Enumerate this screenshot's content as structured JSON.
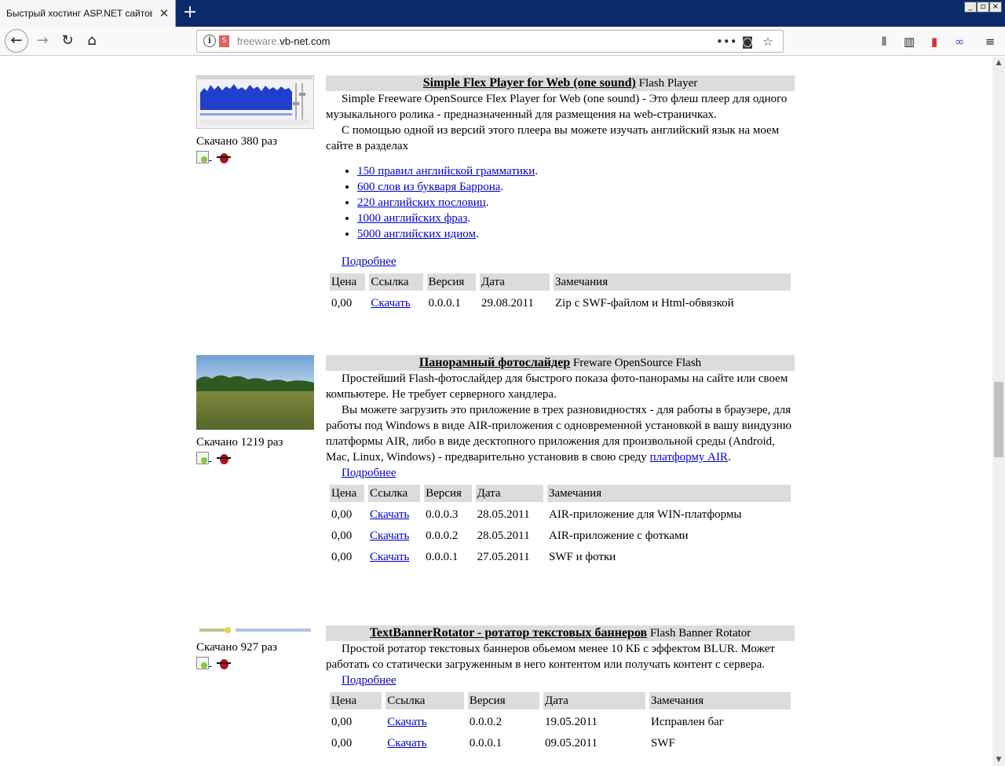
{
  "browser": {
    "tab_title": "Быстрый хостинг ASP.NET сайтов с и",
    "tab_close": "✕",
    "new_tab": "+",
    "url_prefix": "freeware.",
    "url_domain": "vb-net.com",
    "window_controls": {
      "minimize": "_",
      "restore": "▫",
      "close": "×"
    },
    "nav_icons": [
      "back-arrow-icon",
      "forward-arrow-icon",
      "reload-icon",
      "home-icon"
    ],
    "url_icons": [
      "info-icon",
      "noscript-icon",
      "page-actions-icon",
      "pocket-icon",
      "bookmark-star-icon"
    ],
    "toolbar_icons": [
      "library-icon",
      "sidebar-icon",
      "extension-icon",
      "addon-icon",
      "menu-icon"
    ]
  },
  "products": [
    {
      "title": "Simple Flex Player for Web (one sound)",
      "category": "Flash Player",
      "downloads": "Скачано 380 раз",
      "description": [
        "Simple Freeware OpenSource Flex Player for Web (one sound) - Это флеш плеер для одного музыкального ролика - предназначенный для размещения на web-страничках.",
        "С помощью одной из версий этого плеера вы можете изучать английский язык на моем сайте в разделах"
      ],
      "links": [
        "150 правил английской грамматики",
        "600 слов из букваря Баррона",
        "220 английских пословиц",
        "1000 английских фраз",
        "5000 английских идиом"
      ],
      "more": "Подробнее",
      "headers": [
        "Цена",
        "Ссылка",
        "Версия",
        "Дата",
        "Замечания"
      ],
      "rows": [
        {
          "price": "0,00",
          "link": "Скачать",
          "version": "0.0.0.1",
          "date": "29.08.2011",
          "notes": "Zip с SWF-файлом и Html-обвязкой"
        }
      ]
    },
    {
      "title": "Панорамный фотослайдер",
      "category": "Freware OpenSource Flash",
      "downloads": "Скачано 1219 раз",
      "description": [
        "Простейший Flash-фотослайдер для быстрого показа фото-панорамы на сайте или своем компьютере. Не требует серверного хандлера.",
        "Вы можете загрузить это приложение в трех разновидностях - для работы в браузере, для работы под Windows в виде AIR-приложения с одновременной установкой в вашу виндузню платформы AIR, либо в виде десктопного приложения для произвольной среды (Android, Mac, Linux, Windows) - предварительно установив в свою среду"
      ],
      "inline_link": "платформу AIR",
      "more": "Подробнее",
      "headers": [
        "Цена",
        "Ссылка",
        "Версия",
        "Дата",
        "Замечания"
      ],
      "rows": [
        {
          "price": "0,00",
          "link": "Скачать",
          "version": "0.0.0.3",
          "date": "28.05.2011",
          "notes": "AIR-приложение для WIN-платформы"
        },
        {
          "price": "0,00",
          "link": "Скачать",
          "version": "0.0.0.2",
          "date": "28.05.2011",
          "notes": "AIR-приложение с фотками"
        },
        {
          "price": "0,00",
          "link": "Скачать",
          "version": "0.0.0.1",
          "date": "27.05.2011",
          "notes": "SWF и фотки"
        }
      ]
    },
    {
      "title": "TextBannerRotator - ротатор текстовых баннеров",
      "category": "Flash Banner Rotator",
      "downloads": "Скачано 927 раз",
      "description": [
        "Простой ротатор текстовых баннеров обьемом менее 10 КБ с эффектом BLUR. Может работать со статически загруженным в него контентом или получать контент с сервера."
      ],
      "more": "Подробнее",
      "headers": [
        "Цена",
        "Ссылка",
        "Версия",
        "Дата",
        "Замечания"
      ],
      "rows": [
        {
          "price": "0,00",
          "link": "Скачать",
          "version": "0.0.0.2",
          "date": "19.05.2011",
          "notes": "Исправлен баг"
        },
        {
          "price": "0,00",
          "link": "Скачать",
          "version": "0.0.0.1",
          "date": "09.05.2011",
          "notes": "SWF"
        }
      ]
    }
  ]
}
